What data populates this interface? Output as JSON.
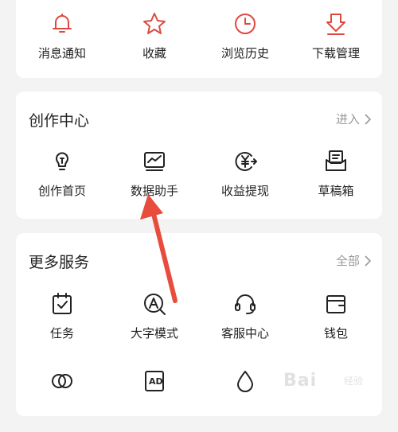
{
  "colors": {
    "accent": "#e0483f",
    "arrow": "#e74c3c",
    "icon": "#222222",
    "muted": "#999999"
  },
  "top_row": [
    {
      "label": "消息通知",
      "icon": "bell-icon"
    },
    {
      "label": "收藏",
      "icon": "star-icon"
    },
    {
      "label": "浏览历史",
      "icon": "clock-icon"
    },
    {
      "label": "下载管理",
      "icon": "download-icon"
    }
  ],
  "create_center": {
    "title": "创作中心",
    "link": "进入",
    "items": [
      {
        "label": "创作首页",
        "icon": "lightbulb-icon"
      },
      {
        "label": "数据助手",
        "icon": "chart-monitor-icon"
      },
      {
        "label": "收益提现",
        "icon": "yuan-withdraw-icon"
      },
      {
        "label": "草稿箱",
        "icon": "draft-box-icon"
      }
    ]
  },
  "more_services": {
    "title": "更多服务",
    "link": "全部",
    "items": [
      {
        "label": "任务",
        "icon": "task-calendar-icon"
      },
      {
        "label": "大字模式",
        "icon": "large-font-icon"
      },
      {
        "label": "客服中心",
        "icon": "headset-icon"
      },
      {
        "label": "钱包",
        "icon": "wallet-icon"
      }
    ],
    "partial_items": [
      {
        "icon": "circles-icon"
      },
      {
        "icon": "ad-icon"
      },
      {
        "icon": "drop-icon"
      }
    ]
  },
  "watermark": {
    "text": "Bai",
    "sub": "经验"
  }
}
